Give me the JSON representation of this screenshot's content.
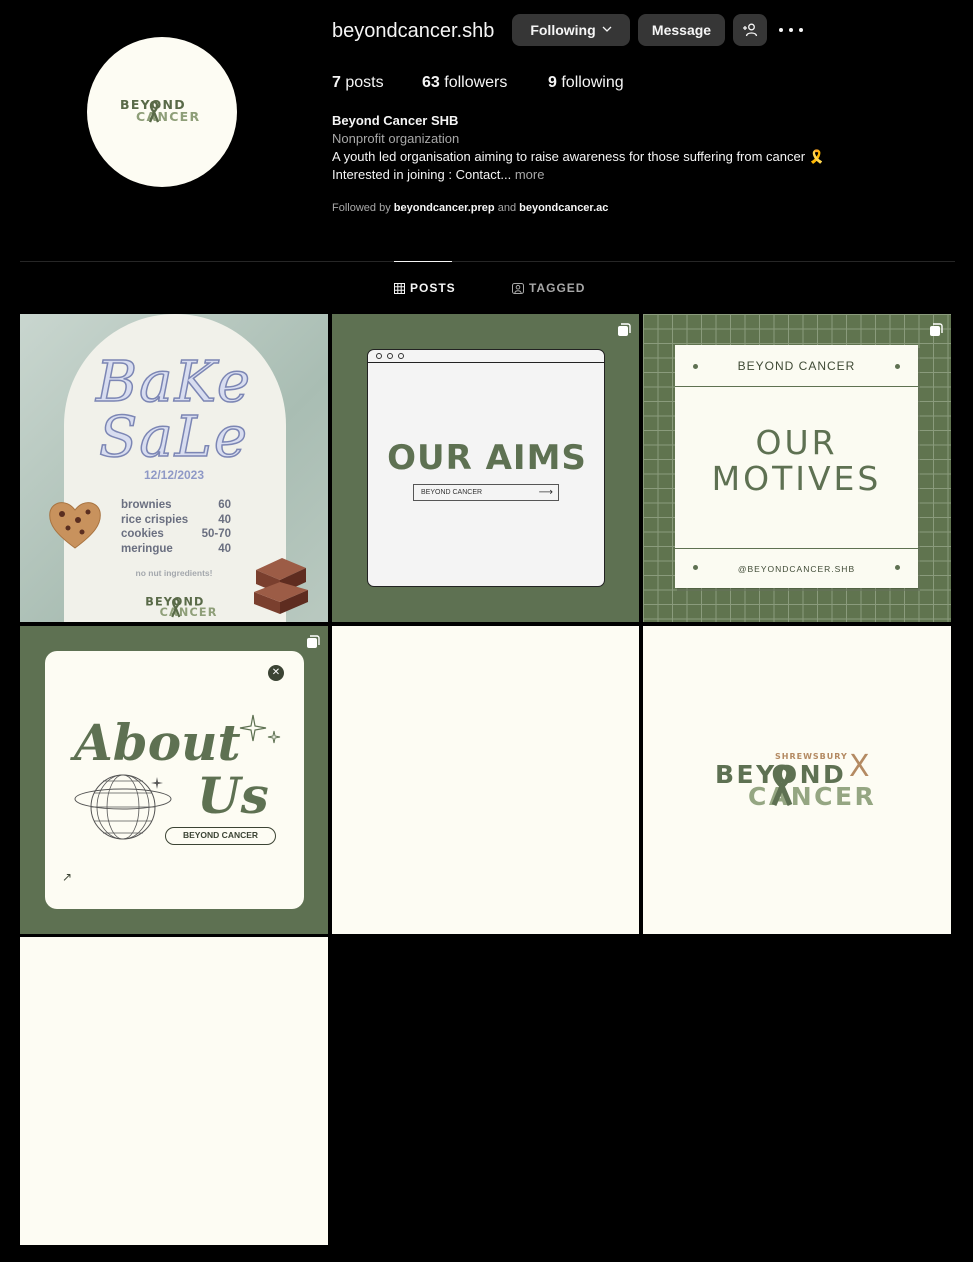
{
  "profile": {
    "username": "beyondcancer.shb",
    "following_label": "Following",
    "message_label": "Message",
    "stats": {
      "posts_count": "7",
      "posts_label": "posts",
      "followers_count": "63",
      "followers_label": "followers",
      "following_count": "9",
      "following_label": "following"
    },
    "bio": {
      "name": "Beyond Cancer SHB",
      "category": "Nonprofit organization",
      "text": "A youth led organisation aiming to raise awareness for those suffering from cancer 🎗️",
      "line2": "Interested in joining : Contact...",
      "more": "more"
    },
    "followed_by": {
      "prefix": "Followed by",
      "user1": "beyondcancer.prep",
      "conj": "and",
      "user2": "beyondcancer.ac"
    }
  },
  "tabs": {
    "posts": "POSTS",
    "tagged": "TAGGED"
  },
  "avatar_logo": {
    "line1": "BEYOND",
    "line2": "CANCER"
  },
  "posts": {
    "bake_sale": {
      "title1": "BaKe",
      "title2": "SaLe",
      "date": "12/12/2023",
      "menu": [
        {
          "item": "brownies",
          "price": "60"
        },
        {
          "item": "rice crispies",
          "price": "40"
        },
        {
          "item": "cookies",
          "price": "50-70"
        },
        {
          "item": "meringue",
          "price": "40"
        }
      ],
      "note": "no nut ingredients!",
      "logo1": "BEYOND",
      "logo2": "CANCER"
    },
    "our_aims": {
      "title": "OUR AIMS",
      "box_label": "BEYOND CANCER",
      "arrow": "⟶"
    },
    "our_motives": {
      "header": "BEYOND CANCER",
      "line1": "OUR",
      "line2": "MOTIVES",
      "footer": "@BEYONDCANCER.SHB"
    },
    "about_us": {
      "line1": "About",
      "line2": "Us",
      "pill": "BEYOND CANCER",
      "close": "✕",
      "arrow": "↗"
    },
    "shrewsbury_logo": {
      "top": "SHREWSBURY",
      "x": "X",
      "line1": "BEYOND",
      "line2": "CANCER"
    }
  },
  "colors": {
    "brand_green": "#5e7152",
    "cream": "#fdfcf3",
    "tan": "#b48a62"
  }
}
